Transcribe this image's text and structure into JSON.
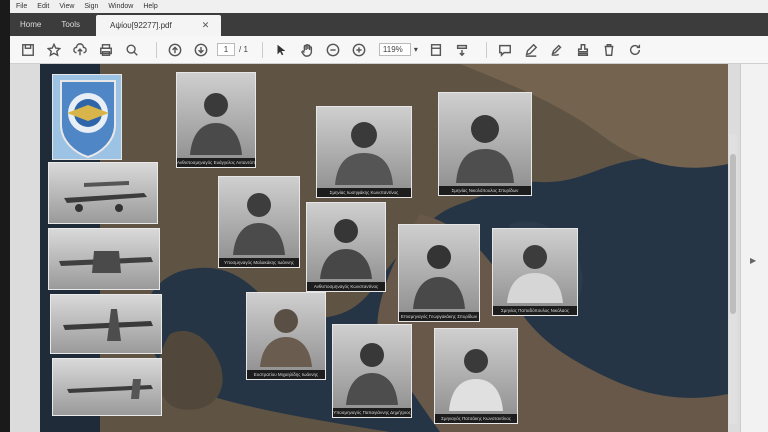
{
  "menu": [
    "File",
    "Edit",
    "View",
    "Sign",
    "Window",
    "Help"
  ],
  "tabs": {
    "home": "Home",
    "tools": "Tools",
    "document": "Αψίου[92277].pdf"
  },
  "toolbar": {
    "page_current": "1",
    "page_total": "/ 1",
    "zoom": "119%"
  },
  "icons": {
    "save": "save-icon",
    "star": "star-icon",
    "upload": "upload-icon",
    "print": "print-icon",
    "search": "search-icon",
    "page_up": "page-up-icon",
    "page_down": "page-down-icon",
    "select": "select-arrow-icon",
    "hand": "hand-icon",
    "zoom_out": "zoom-out-icon",
    "zoom_in": "zoom-in-icon",
    "fit": "fit-page-icon",
    "scroll": "scroll-mode-icon",
    "comment": "comment-icon",
    "pen": "pen-icon",
    "sign": "sign-icon",
    "stamp": "stamp-icon",
    "delete": "delete-icon",
    "rotate": "rotate-icon"
  },
  "portraits": [
    {
      "caption": "Ανθυποσμηναγός Ευάγγελος Ανταντόπουλος"
    },
    {
      "caption": "Σμηνίας Ιωσηφάκης Κωνσταντίνος"
    },
    {
      "caption": "Σμηνίας Νικολόπουλος Σπυρίδων"
    },
    {
      "caption": "Υποσμηναγός Μαλακάκης Ιωάννης"
    },
    {
      "caption": "Ανθυποσμηναγός Κωνσταντίνος"
    },
    {
      "caption": "Επισμηναγός Γεωργακάκης Σπυρίδων"
    },
    {
      "caption": "Σμηνίας Παπαδόπουλος Νικόλαος"
    },
    {
      "caption": "Ευστρατίου Μιχαηλίδης Ιωάννης"
    },
    {
      "caption": "Υποσμηναγός Παπαγιάννης Δημήτριος"
    },
    {
      "caption": "Σμηναγός Πατσάκης Κωνσταντίνος"
    }
  ],
  "colors": {
    "sea": "#243443",
    "land": "#6a5a45",
    "toolbar_bg": "#f7f7f7",
    "tab_bg": "#3c3c3c"
  }
}
